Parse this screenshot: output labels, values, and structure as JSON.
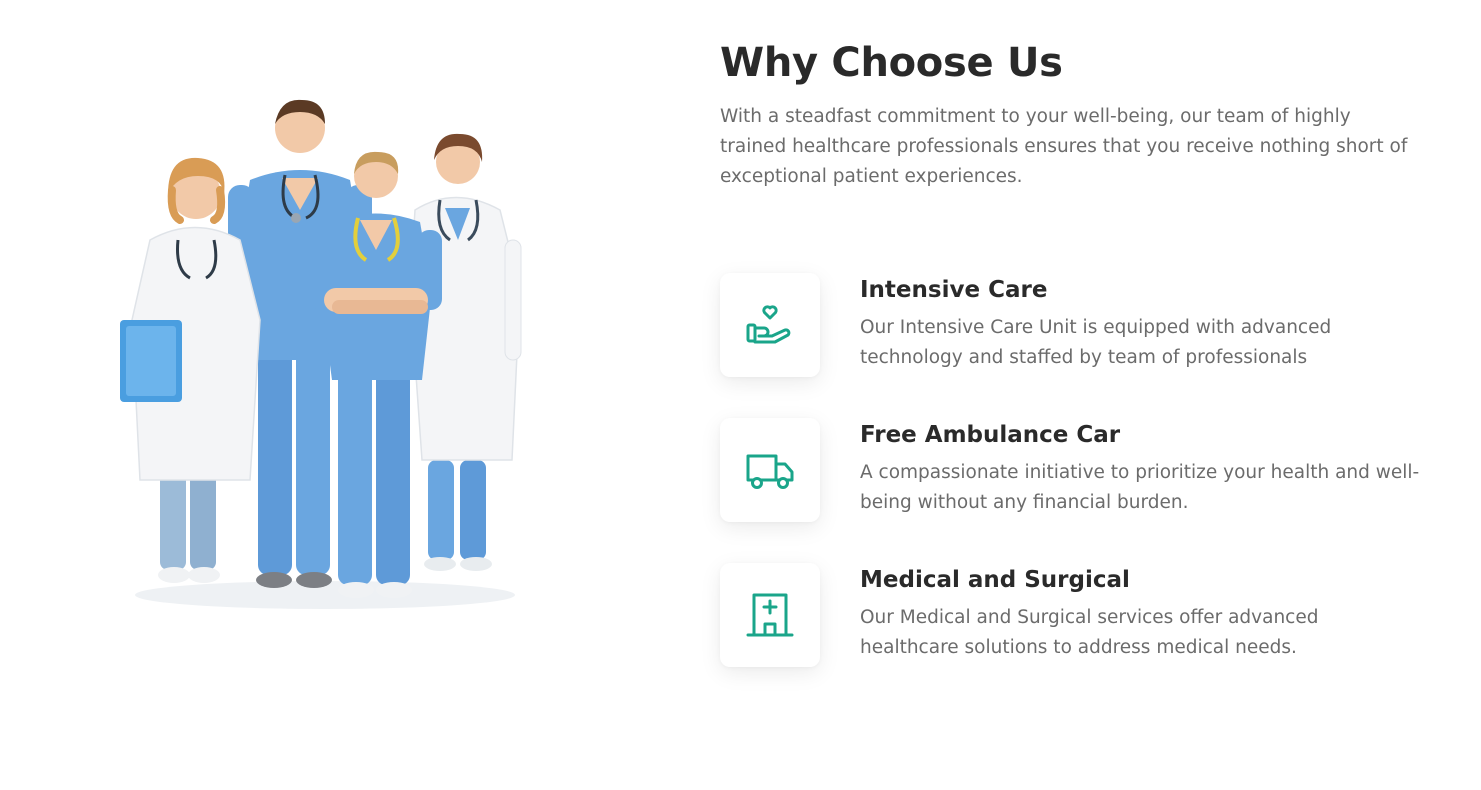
{
  "section": {
    "title": "Why Choose Us",
    "intro": "With a steadfast commitment to your well-being, our team of highly trained healthcare professionals ensures that you receive nothing short of exceptional patient experiences."
  },
  "features": [
    {
      "title": "Intensive Care",
      "description": "Our Intensive Care Unit is equipped with advanced technology and staffed by team of professionals",
      "icon": "heart-hand-icon"
    },
    {
      "title": "Free Ambulance Car",
      "description": "A compassionate initiative to prioritize your health and well-being without any financial burden.",
      "icon": "ambulance-truck-icon"
    },
    {
      "title": "Medical and Surgical",
      "description": "Our Medical and Surgical services offer advanced healthcare solutions to address medical needs.",
      "icon": "hospital-building-icon"
    }
  ],
  "colors": {
    "accent": "#1aa58a",
    "heading": "#2a2a2a",
    "body_text": "#6b6b6b",
    "scrubs": "#6aa6e0",
    "lab_coat": "#f4f5f7"
  }
}
